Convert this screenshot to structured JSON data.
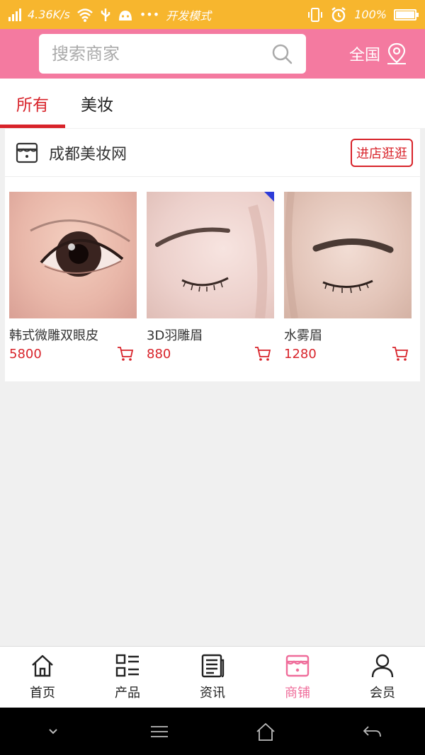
{
  "status_bar": {
    "speed": "4.36K/s",
    "dev_mode": "开发模式",
    "more": "•••",
    "battery": "100%"
  },
  "header": {
    "search_placeholder": "搜索商家",
    "region_label": "全国",
    "accent_color": "#f47aa0"
  },
  "tabs": [
    {
      "label": "所有",
      "active": true
    },
    {
      "label": "美妆",
      "active": false
    }
  ],
  "shop": {
    "name": "成都美妆网",
    "enter_label": "进店逛逛",
    "products": [
      {
        "name": "韩式微雕双眼皮",
        "price": "5800"
      },
      {
        "name": "3D羽雕眉",
        "price": "880"
      },
      {
        "name": "水雾眉",
        "price": "1280"
      }
    ]
  },
  "bottom_nav": [
    {
      "label": "首页",
      "icon": "home-icon",
      "active": false
    },
    {
      "label": "产品",
      "icon": "list-icon",
      "active": false
    },
    {
      "label": "资讯",
      "icon": "news-icon",
      "active": false
    },
    {
      "label": "商铺",
      "icon": "store-icon",
      "active": true
    },
    {
      "label": "会员",
      "icon": "user-icon",
      "active": false
    }
  ],
  "colors": {
    "status_bar": "#f7b62e",
    "price_red": "#d8232a",
    "active_pink": "#ef6c9a"
  }
}
